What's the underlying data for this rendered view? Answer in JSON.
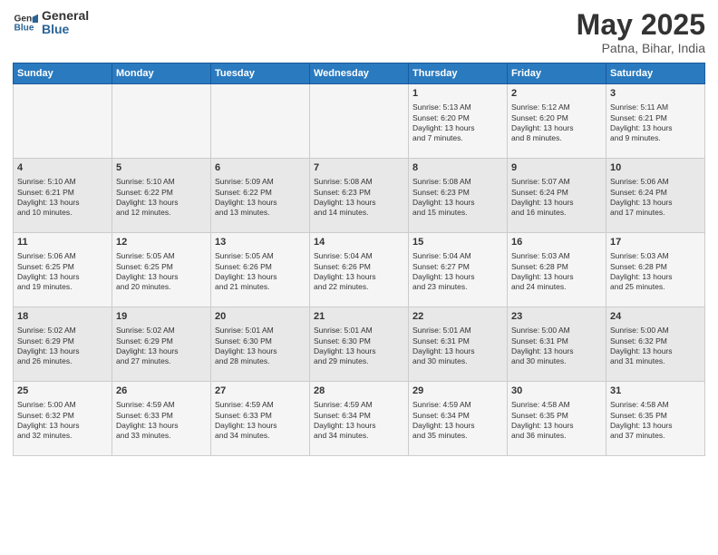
{
  "header": {
    "logo_line1": "General",
    "logo_line2": "Blue",
    "title": "May 2025",
    "subtitle": "Patna, Bihar, India"
  },
  "days_of_week": [
    "Sunday",
    "Monday",
    "Tuesday",
    "Wednesday",
    "Thursday",
    "Friday",
    "Saturday"
  ],
  "weeks": [
    [
      {
        "day": "",
        "content": ""
      },
      {
        "day": "",
        "content": ""
      },
      {
        "day": "",
        "content": ""
      },
      {
        "day": "",
        "content": ""
      },
      {
        "day": "1",
        "content": "Sunrise: 5:13 AM\nSunset: 6:20 PM\nDaylight: 13 hours\nand 7 minutes."
      },
      {
        "day": "2",
        "content": "Sunrise: 5:12 AM\nSunset: 6:20 PM\nDaylight: 13 hours\nand 8 minutes."
      },
      {
        "day": "3",
        "content": "Sunrise: 5:11 AM\nSunset: 6:21 PM\nDaylight: 13 hours\nand 9 minutes."
      }
    ],
    [
      {
        "day": "4",
        "content": "Sunrise: 5:10 AM\nSunset: 6:21 PM\nDaylight: 13 hours\nand 10 minutes."
      },
      {
        "day": "5",
        "content": "Sunrise: 5:10 AM\nSunset: 6:22 PM\nDaylight: 13 hours\nand 12 minutes."
      },
      {
        "day": "6",
        "content": "Sunrise: 5:09 AM\nSunset: 6:22 PM\nDaylight: 13 hours\nand 13 minutes."
      },
      {
        "day": "7",
        "content": "Sunrise: 5:08 AM\nSunset: 6:23 PM\nDaylight: 13 hours\nand 14 minutes."
      },
      {
        "day": "8",
        "content": "Sunrise: 5:08 AM\nSunset: 6:23 PM\nDaylight: 13 hours\nand 15 minutes."
      },
      {
        "day": "9",
        "content": "Sunrise: 5:07 AM\nSunset: 6:24 PM\nDaylight: 13 hours\nand 16 minutes."
      },
      {
        "day": "10",
        "content": "Sunrise: 5:06 AM\nSunset: 6:24 PM\nDaylight: 13 hours\nand 17 minutes."
      }
    ],
    [
      {
        "day": "11",
        "content": "Sunrise: 5:06 AM\nSunset: 6:25 PM\nDaylight: 13 hours\nand 19 minutes."
      },
      {
        "day": "12",
        "content": "Sunrise: 5:05 AM\nSunset: 6:25 PM\nDaylight: 13 hours\nand 20 minutes."
      },
      {
        "day": "13",
        "content": "Sunrise: 5:05 AM\nSunset: 6:26 PM\nDaylight: 13 hours\nand 21 minutes."
      },
      {
        "day": "14",
        "content": "Sunrise: 5:04 AM\nSunset: 6:26 PM\nDaylight: 13 hours\nand 22 minutes."
      },
      {
        "day": "15",
        "content": "Sunrise: 5:04 AM\nSunset: 6:27 PM\nDaylight: 13 hours\nand 23 minutes."
      },
      {
        "day": "16",
        "content": "Sunrise: 5:03 AM\nSunset: 6:28 PM\nDaylight: 13 hours\nand 24 minutes."
      },
      {
        "day": "17",
        "content": "Sunrise: 5:03 AM\nSunset: 6:28 PM\nDaylight: 13 hours\nand 25 minutes."
      }
    ],
    [
      {
        "day": "18",
        "content": "Sunrise: 5:02 AM\nSunset: 6:29 PM\nDaylight: 13 hours\nand 26 minutes."
      },
      {
        "day": "19",
        "content": "Sunrise: 5:02 AM\nSunset: 6:29 PM\nDaylight: 13 hours\nand 27 minutes."
      },
      {
        "day": "20",
        "content": "Sunrise: 5:01 AM\nSunset: 6:30 PM\nDaylight: 13 hours\nand 28 minutes."
      },
      {
        "day": "21",
        "content": "Sunrise: 5:01 AM\nSunset: 6:30 PM\nDaylight: 13 hours\nand 29 minutes."
      },
      {
        "day": "22",
        "content": "Sunrise: 5:01 AM\nSunset: 6:31 PM\nDaylight: 13 hours\nand 30 minutes."
      },
      {
        "day": "23",
        "content": "Sunrise: 5:00 AM\nSunset: 6:31 PM\nDaylight: 13 hours\nand 30 minutes."
      },
      {
        "day": "24",
        "content": "Sunrise: 5:00 AM\nSunset: 6:32 PM\nDaylight: 13 hours\nand 31 minutes."
      }
    ],
    [
      {
        "day": "25",
        "content": "Sunrise: 5:00 AM\nSunset: 6:32 PM\nDaylight: 13 hours\nand 32 minutes."
      },
      {
        "day": "26",
        "content": "Sunrise: 4:59 AM\nSunset: 6:33 PM\nDaylight: 13 hours\nand 33 minutes."
      },
      {
        "day": "27",
        "content": "Sunrise: 4:59 AM\nSunset: 6:33 PM\nDaylight: 13 hours\nand 34 minutes."
      },
      {
        "day": "28",
        "content": "Sunrise: 4:59 AM\nSunset: 6:34 PM\nDaylight: 13 hours\nand 34 minutes."
      },
      {
        "day": "29",
        "content": "Sunrise: 4:59 AM\nSunset: 6:34 PM\nDaylight: 13 hours\nand 35 minutes."
      },
      {
        "day": "30",
        "content": "Sunrise: 4:58 AM\nSunset: 6:35 PM\nDaylight: 13 hours\nand 36 minutes."
      },
      {
        "day": "31",
        "content": "Sunrise: 4:58 AM\nSunset: 6:35 PM\nDaylight: 13 hours\nand 37 minutes."
      }
    ]
  ]
}
